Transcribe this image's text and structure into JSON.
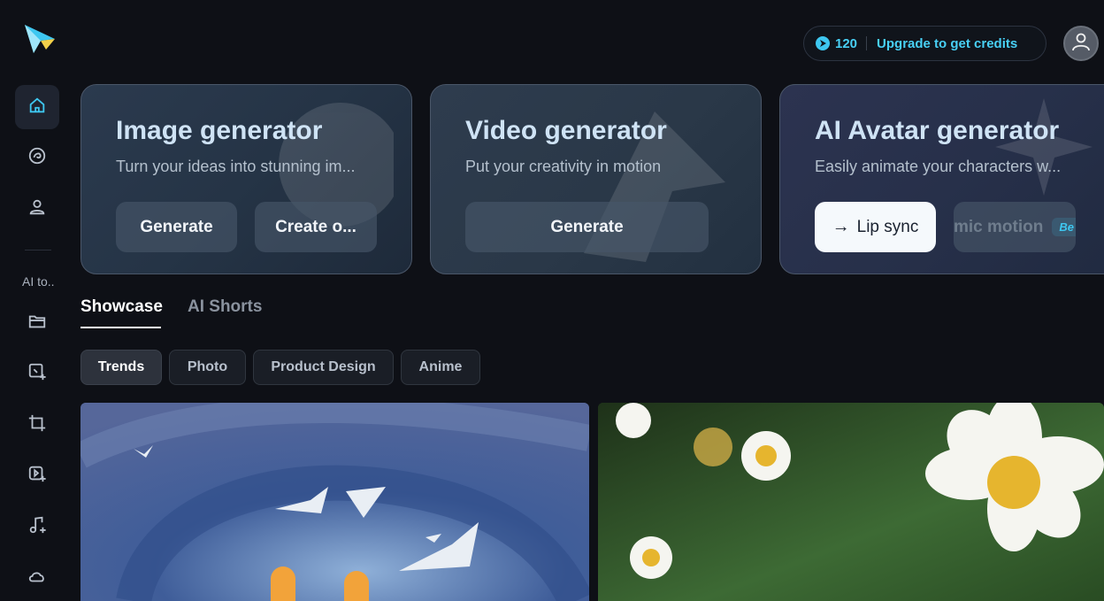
{
  "sidebar": {
    "logo": "app-logo",
    "items": [
      {
        "icon": "home-icon",
        "active": true
      },
      {
        "icon": "swirl-icon",
        "active": false
      },
      {
        "icon": "user-icon",
        "active": false
      }
    ],
    "section_label": "AI to..",
    "tools": [
      {
        "icon": "folder-icon"
      },
      {
        "icon": "image-sparkle-icon"
      },
      {
        "icon": "crop-icon"
      },
      {
        "icon": "video-sparkle-icon"
      },
      {
        "icon": "music-icon"
      },
      {
        "icon": "cloud-icon"
      }
    ]
  },
  "header": {
    "credits_count": "120",
    "upgrade_label": "Upgrade to get credits",
    "avatar_icon": "user-avatar-icon"
  },
  "cards": [
    {
      "title": "Image generator",
      "subtitle": "Turn your ideas into stunning im...",
      "buttons": [
        "Generate",
        "Create o..."
      ]
    },
    {
      "title": "Video generator",
      "subtitle": "Put your creativity in motion",
      "buttons": [
        "Generate"
      ]
    },
    {
      "title": "AI Avatar generator",
      "subtitle": "Easily animate your characters w...",
      "buttons": [
        "Lip sync",
        "mic motion"
      ],
      "badge": "Be"
    }
  ],
  "tabs": [
    "Showcase",
    "AI Shorts"
  ],
  "chips": [
    "Trends",
    "Photo",
    "Product Design",
    "Anime"
  ],
  "colors": {
    "accent": "#3ec7f0",
    "background": "#0e1016"
  }
}
